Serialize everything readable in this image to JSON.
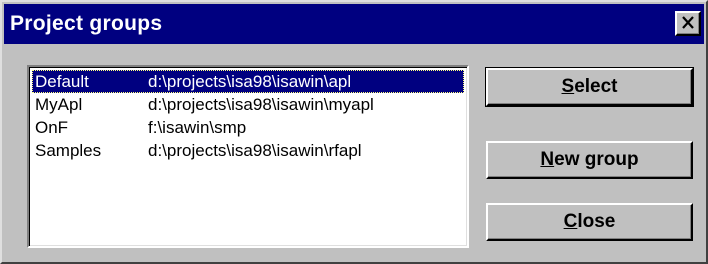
{
  "window": {
    "title": "Project groups",
    "close_glyph": "✕"
  },
  "groups": [
    {
      "name": "Default",
      "path": "d:\\projects\\isa98\\isawin\\apl",
      "selected": true
    },
    {
      "name": "MyApl",
      "path": "d:\\projects\\isa98\\isawin\\myapl",
      "selected": false
    },
    {
      "name": "OnF",
      "path": "f:\\isawin\\smp",
      "selected": false
    },
    {
      "name": "Samples",
      "path": "d:\\projects\\isa98\\isawin\\rfapl",
      "selected": false
    }
  ],
  "buttons": {
    "select": {
      "mnemonic": "S",
      "rest": "elect"
    },
    "new_group": {
      "mnemonic": "N",
      "rest": "ew group"
    },
    "close": {
      "mnemonic": "C",
      "rest": "lose"
    }
  },
  "colors": {
    "titlebar": "#000080",
    "face": "#c0c0c0",
    "selection": "#000080"
  }
}
